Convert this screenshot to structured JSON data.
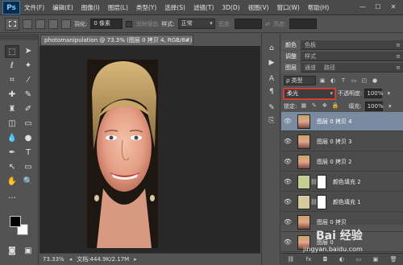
{
  "app": {
    "logo": "Ps"
  },
  "menu": [
    "文件(F)",
    "编辑(E)",
    "图像(I)",
    "图层(L)",
    "类型(Y)",
    "选择(S)",
    "滤镜(T)",
    "3D(D)",
    "视图(V)",
    "窗口(W)",
    "帮助(H)"
  ],
  "window_controls": [
    "—",
    "☐",
    "✕"
  ],
  "options": {
    "feather_label": "羽化:",
    "feather_value": "0 像素",
    "antialias_label": "消除锯齿",
    "style_label": "样式:",
    "style_value": "正常",
    "width_label": "宽度:",
    "height_label": "高度:"
  },
  "document": {
    "tab_title": "photomanipulation @ 73.3% (图层 0 拷贝 4, RGB/8#) *",
    "close": "×",
    "zoom": "73.33%",
    "doc_info": "文档:444.9K/2.17M"
  },
  "panels": {
    "group1_tabs": [
      "颜色",
      "色板"
    ],
    "group2_tabs": [
      "调整",
      "样式"
    ],
    "group3_tabs": [
      "图层",
      "通道",
      "路径"
    ],
    "filter_kind": "ρ 类型",
    "blend_mode": "柔光",
    "opacity_label": "不透明度:",
    "opacity_value": "100%",
    "lock_label": "锁定:",
    "fill_label": "填充:",
    "fill_value": "100%"
  },
  "layers": [
    {
      "name": "图层 0 拷贝 4",
      "type": "photo",
      "selected": true
    },
    {
      "name": "图层 0 拷贝 3",
      "type": "photo",
      "selected": false
    },
    {
      "name": "图层 0 拷贝 2",
      "type": "photo",
      "selected": false
    },
    {
      "name": "颜色填充 2",
      "type": "fill",
      "color": "#c5cc94",
      "selected": false
    },
    {
      "name": "颜色填充 1",
      "type": "fill",
      "color": "#d6c9a0",
      "selected": false
    },
    {
      "name": "图层 0 拷贝",
      "type": "photo",
      "selected": false
    },
    {
      "name": "图层 0",
      "type": "photo",
      "selected": false
    }
  ],
  "watermark": {
    "main": "Bai 经验",
    "url": "jingyan.baidu.com"
  },
  "colors": {
    "selected_layer": "#7a8aa0",
    "blend_highlight": "#e04040"
  }
}
